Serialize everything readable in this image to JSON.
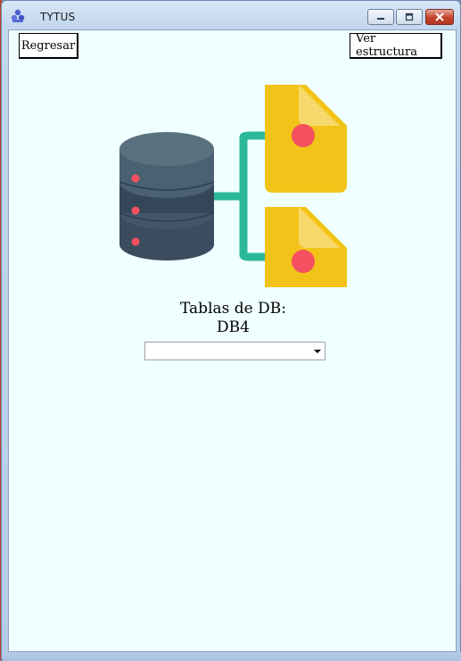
{
  "window": {
    "title": "TYTUS",
    "icon": "app-logo-icon",
    "controls": {
      "minimize": "minimize-icon",
      "maximize": "maximize-icon",
      "close": "close-icon"
    }
  },
  "toolbar": {
    "back_label": "Regresar",
    "structure_label": "Ver estructura"
  },
  "illustration": {
    "icon": "database-to-files-icon"
  },
  "main": {
    "heading_line1": "Tablas de DB:",
    "heading_line2": "DB4"
  },
  "table_select": {
    "value": "",
    "options": []
  },
  "colors": {
    "client_bg": "#f0ffff",
    "db_dark": "#3a4c5e",
    "db_light": "#5a7280",
    "connector": "#2bb89a",
    "file": "#f2c318",
    "dot": "#f4505f"
  }
}
